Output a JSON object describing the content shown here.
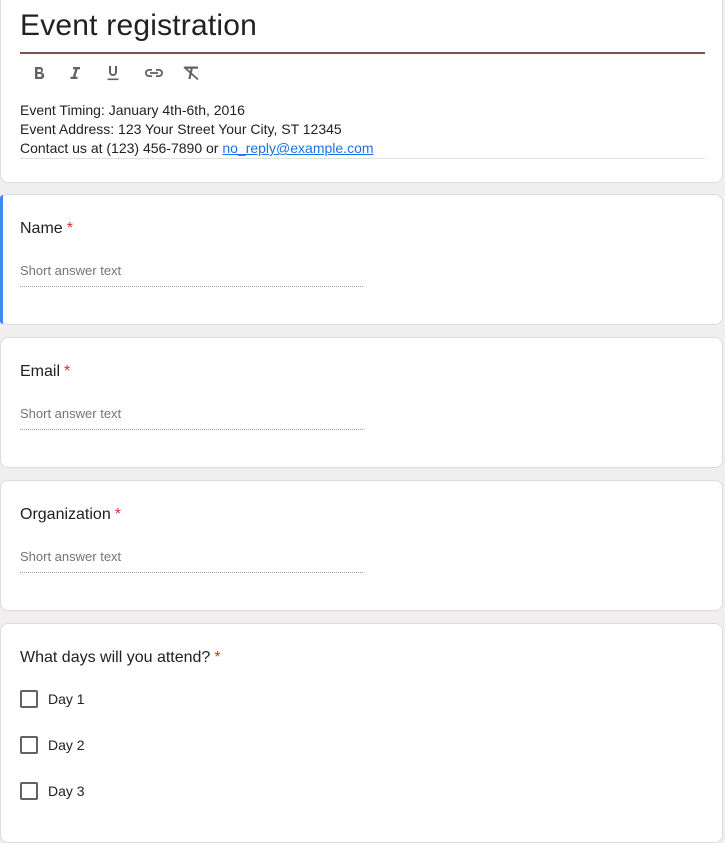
{
  "form": {
    "title": "Event registration",
    "toolbar": {
      "bold_icon": "bold-icon",
      "italic_icon": "italic-icon",
      "underline_icon": "underline-icon",
      "link_icon": "link-icon",
      "clear_format_icon": "clear-formatting-icon"
    },
    "description": {
      "line1": "Event Timing: January 4th-6th, 2016",
      "line2": "Event Address: 123 Your Street Your City, ST 12345",
      "line3_prefix": "Contact us at (123) 456-7890 or ",
      "line3_email": "no_reply@example.com"
    },
    "accent_color": "#4285f4",
    "theme_color": "#795548",
    "required_color": "#d93025"
  },
  "questions": [
    {
      "title": "Name",
      "required_mark": "*",
      "placeholder": "Short answer text"
    },
    {
      "title": "Email",
      "required_mark": "*",
      "placeholder": "Short answer text"
    },
    {
      "title": "Organization",
      "required_mark": "*",
      "placeholder": "Short answer text"
    },
    {
      "title": "What days will you attend?",
      "required_mark": "*",
      "options": [
        "Day 1",
        "Day 2",
        "Day 3"
      ]
    }
  ]
}
